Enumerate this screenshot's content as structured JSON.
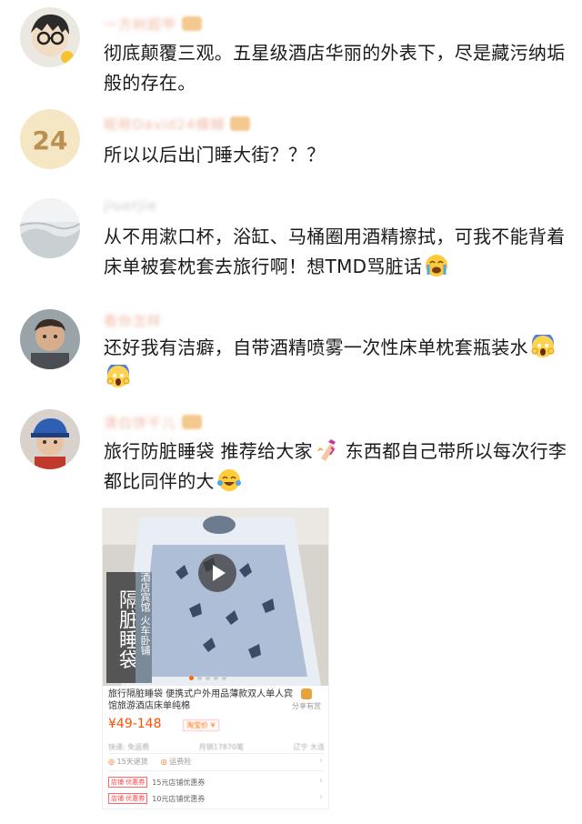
{
  "comments": [
    {
      "username": "一方树超甲",
      "text": "彻底颠覆三观。五星级酒店华丽的外表下，尽是藏污纳垢般的存在。",
      "avatar": "avatar-cartoon-glasses"
    },
    {
      "username": "昵称David24模糊",
      "text": "所以以后出门睡大街？？？",
      "avatar": "avatar-number-24",
      "avatar_text": "24"
    },
    {
      "username": "jiuerjie",
      "text": "从不用漱口杯，浴缸、马桶圈用酒精擦拭，可我不能背着床单被套枕套去旅行啊！想TMD骂脏话",
      "avatar": "avatar-landscape",
      "emoji": [
        "crying-face-emoji"
      ]
    },
    {
      "username": "看你怎样",
      "text": "还好我有洁癖，自带酒精喷雾一次性床单枕套瓶装水",
      "avatar": "avatar-person",
      "emoji": [
        "screaming-face-emoji",
        "screaming-face-emoji"
      ]
    },
    {
      "username": "清白饼干儿",
      "text_before": "旅行防脏睡袋 推荐给大家",
      "text_after": " 东西都自己带所以每次行李都比同伴的大",
      "avatar": "avatar-cap-person",
      "emoji": [
        "nail-polish-emoji",
        "laughing-tears-emoji"
      ]
    }
  ],
  "product": {
    "banner_main": "隔脏睡袋",
    "banner_sub": "酒店宾馆 火车卧铺",
    "title": "旅行隔脏睡袋 便携式户外用品薄款双人单人宾馆旅游酒店床单纯棉",
    "share_label": "分享有赏",
    "price": "¥49-148",
    "price_tag": "淘宝价 ¥",
    "meta": [
      "快递: 免运费",
      "月销17870笔",
      "辽宁 大连"
    ],
    "services": [
      "15天退货",
      "运费险"
    ],
    "coupons": [
      {
        "tag": "店铺 优惠券",
        "text": "15元店铺优惠券"
      },
      {
        "tag": "店铺 优惠券",
        "text": "10元店铺优惠券"
      }
    ]
  },
  "colors": {
    "username": "#f0b9a6",
    "price": "#ff5000",
    "text": "#1a1a1a"
  }
}
